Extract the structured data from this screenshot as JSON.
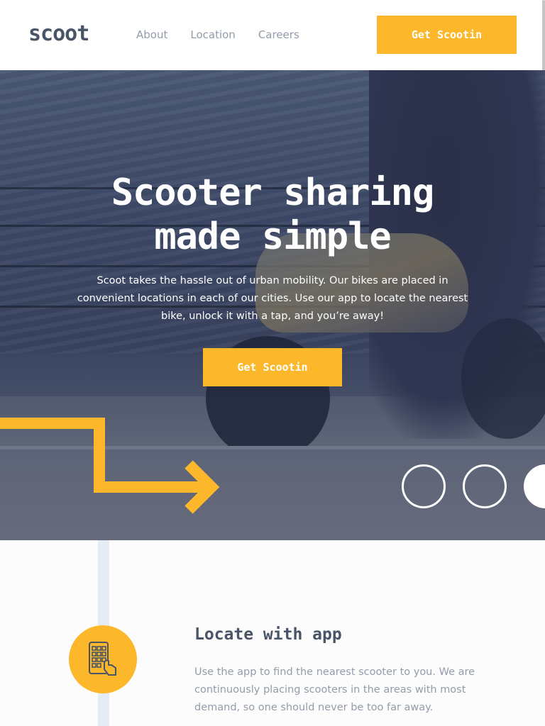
{
  "header": {
    "logo": "scoot",
    "nav": [
      {
        "label": "About"
      },
      {
        "label": "Location"
      },
      {
        "label": "Careers"
      }
    ],
    "cta": "Get Scootin"
  },
  "hero": {
    "title_line1": "Scooter sharing",
    "title_line2": "made simple",
    "text": "Scoot takes the hassle out of urban mobility. Our bikes are placed in convenient locations in each of our cities. Use our app to locate the nearest bike, unlock it with a tap, and you’re away!",
    "cta": "Get Scootin"
  },
  "feature": {
    "icon": "phone-tap-icon",
    "title": "Locate with app",
    "text": "Use the app to find the nearest scooter to you. We are continuously placing scooters in the areas with most demand, so one should never be too far away."
  },
  "colors": {
    "accent": "#fcb72b",
    "dark": "#495567",
    "muted": "#939caa",
    "hero_overlay": "#3c4866"
  }
}
